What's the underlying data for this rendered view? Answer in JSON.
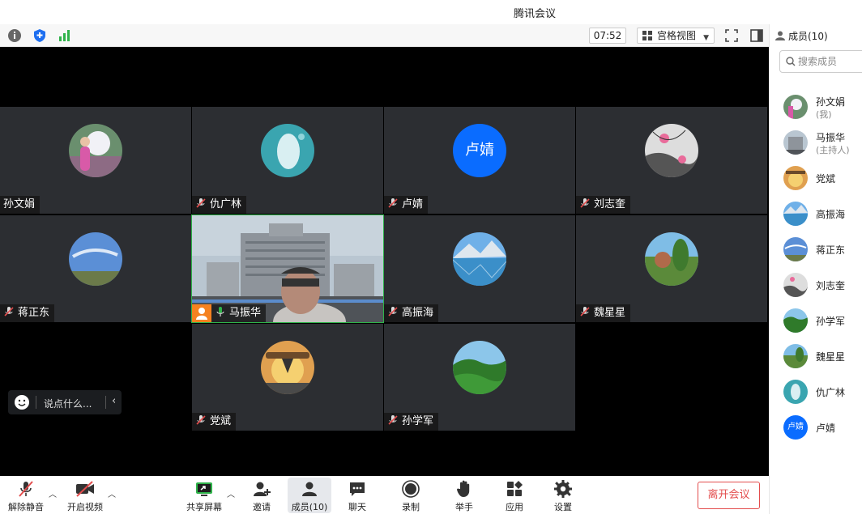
{
  "window": {
    "title": "腾讯会议"
  },
  "topbar": {
    "timer": "07:52",
    "view_label": "宫格视图"
  },
  "stage": {
    "tiles": [
      {
        "name": "孙文娟",
        "muted": false,
        "avatar": "photo-girl"
      },
      {
        "name": "仇广林",
        "muted": true,
        "avatar": "photo-whale"
      },
      {
        "name": "卢婧",
        "muted": true,
        "avatar_text": "卢婧"
      },
      {
        "name": "刘志奎",
        "muted": true,
        "avatar": "photo-lotus"
      },
      {
        "name": "蒋正东",
        "muted": true,
        "avatar": "photo-sky"
      },
      {
        "name": "马振华",
        "muted": false,
        "video": true,
        "host": true
      },
      {
        "name": "高振海",
        "muted": true,
        "avatar": "photo-lake"
      },
      {
        "name": "魏星星",
        "muted": true,
        "avatar": "photo-garden"
      },
      {
        "name": "党斌",
        "muted": true,
        "avatar": "photo-sunset"
      },
      {
        "name": "孙学军",
        "muted": true,
        "avatar": "photo-forest"
      }
    ],
    "chat_placeholder": "说点什么..."
  },
  "bottombar": {
    "unmute": "解除静音",
    "start_video": "开启视频",
    "share_screen": "共享屏幕",
    "invite": "邀请",
    "members": "成员(10)",
    "chat": "聊天",
    "record": "录制",
    "raise_hand": "举手",
    "apps": "应用",
    "settings": "设置",
    "leave": "离开会议"
  },
  "panel": {
    "title": "成员(10)",
    "search_placeholder": "搜索成员",
    "members": [
      {
        "name": "孙文娟",
        "role": "(我)"
      },
      {
        "name": "马振华",
        "role": "(主持人)"
      },
      {
        "name": "党斌",
        "role": ""
      },
      {
        "name": "高振海",
        "role": ""
      },
      {
        "name": "蒋正东",
        "role": ""
      },
      {
        "name": "刘志奎",
        "role": ""
      },
      {
        "name": "孙学军",
        "role": ""
      },
      {
        "name": "魏星星",
        "role": ""
      },
      {
        "name": "仇广林",
        "role": ""
      },
      {
        "name": "卢婧",
        "role": "",
        "avatar_text": "卢婧"
      }
    ]
  },
  "colors": {
    "accent": "#0a6cff",
    "leave": "#e34d4d",
    "active_speaker": "#2fb34a",
    "host_badge": "#f58220"
  }
}
